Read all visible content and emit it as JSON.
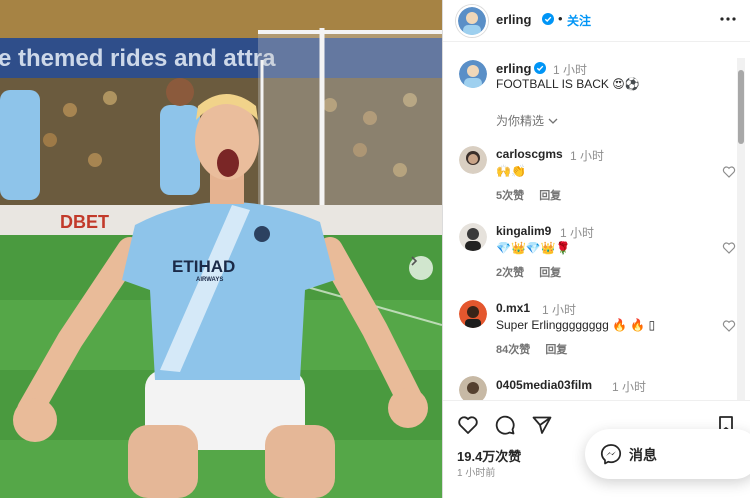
{
  "post": {
    "author": "erling",
    "follow_label": "关注",
    "header_dot": "•",
    "caption": {
      "time": "1 小时",
      "text": "FOOTBALL IS BACK",
      "emoji": "😍⚽"
    },
    "filter_label": "为你精选",
    "stadium_banner": "e themed rides and attra",
    "shirt_sponsor": "ETIHAD",
    "shirt_sponsor_sub": "AIRWAYS",
    "ad_board": "DBET",
    "likes": "19.4万次赞",
    "posted": "1 小时前"
  },
  "comments": [
    {
      "user": "carloscgms",
      "time": "1 小时",
      "text": "🙌👏",
      "likes": "5次赞",
      "reply": "回复"
    },
    {
      "user": "kingalim9",
      "time": "1 小时",
      "text": "💎👑💎👑🌹",
      "likes": "2次赞",
      "reply": "回复"
    },
    {
      "user": "0.mx1",
      "time": "1 小时",
      "text": "Super Erlingggggggg 🔥 🔥 ▯",
      "likes": "84次赞",
      "reply": "回复"
    },
    {
      "user": "0405media03film",
      "time": "1 小时"
    }
  ],
  "messages": {
    "label": "消息"
  },
  "colors": {
    "link_blue": "#0095f6",
    "verified": "#0095f6",
    "meta_grey": "#8e8e8e",
    "sky_blue_kit": "#8ec4ea"
  }
}
